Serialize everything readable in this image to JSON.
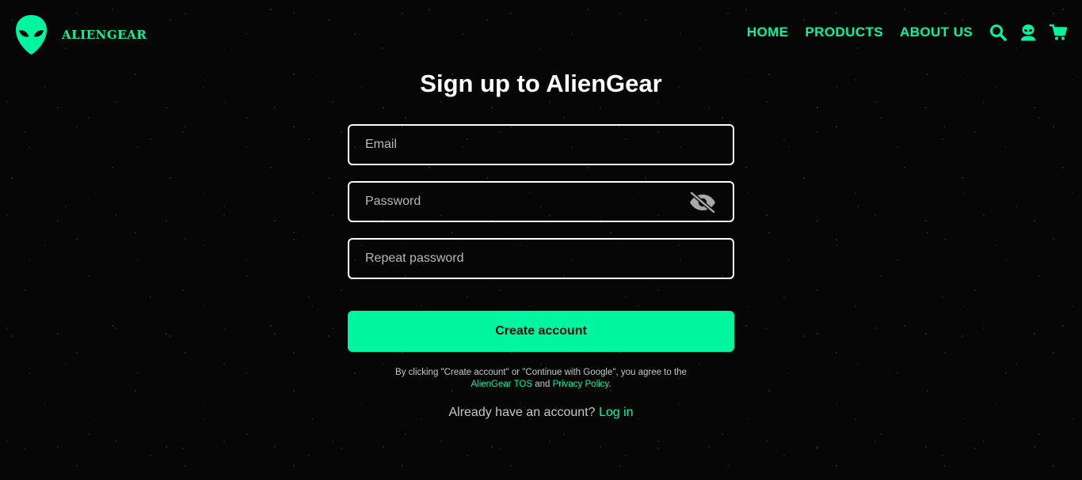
{
  "brand": {
    "name": "ALIENGEAR",
    "accent_color": "#00f5a0",
    "logo_icon": "alien-head-icon"
  },
  "nav": {
    "links": [
      {
        "label": "HOME"
      },
      {
        "label": "PRODUCTS"
      },
      {
        "label": "ABOUT US"
      }
    ],
    "icons": [
      "search-icon",
      "user-icon",
      "cart-icon"
    ]
  },
  "signup": {
    "title": "Sign up to AlienGear",
    "email_placeholder": "Email",
    "password_placeholder": "Password",
    "repeat_placeholder": "Repeat password",
    "password_toggle_icon": "eye-slash-icon",
    "submit_label": "Create account",
    "terms": {
      "prefix": "By clicking \"Create account\" or \"Continue with Google\", you agree to the ",
      "tos_link": "AlienGear TOS",
      "middle": " and ",
      "privacy_link": "Privacy Policy",
      "suffix": "."
    },
    "login": {
      "prompt": "Already have an account? ",
      "link": "Log in"
    }
  }
}
